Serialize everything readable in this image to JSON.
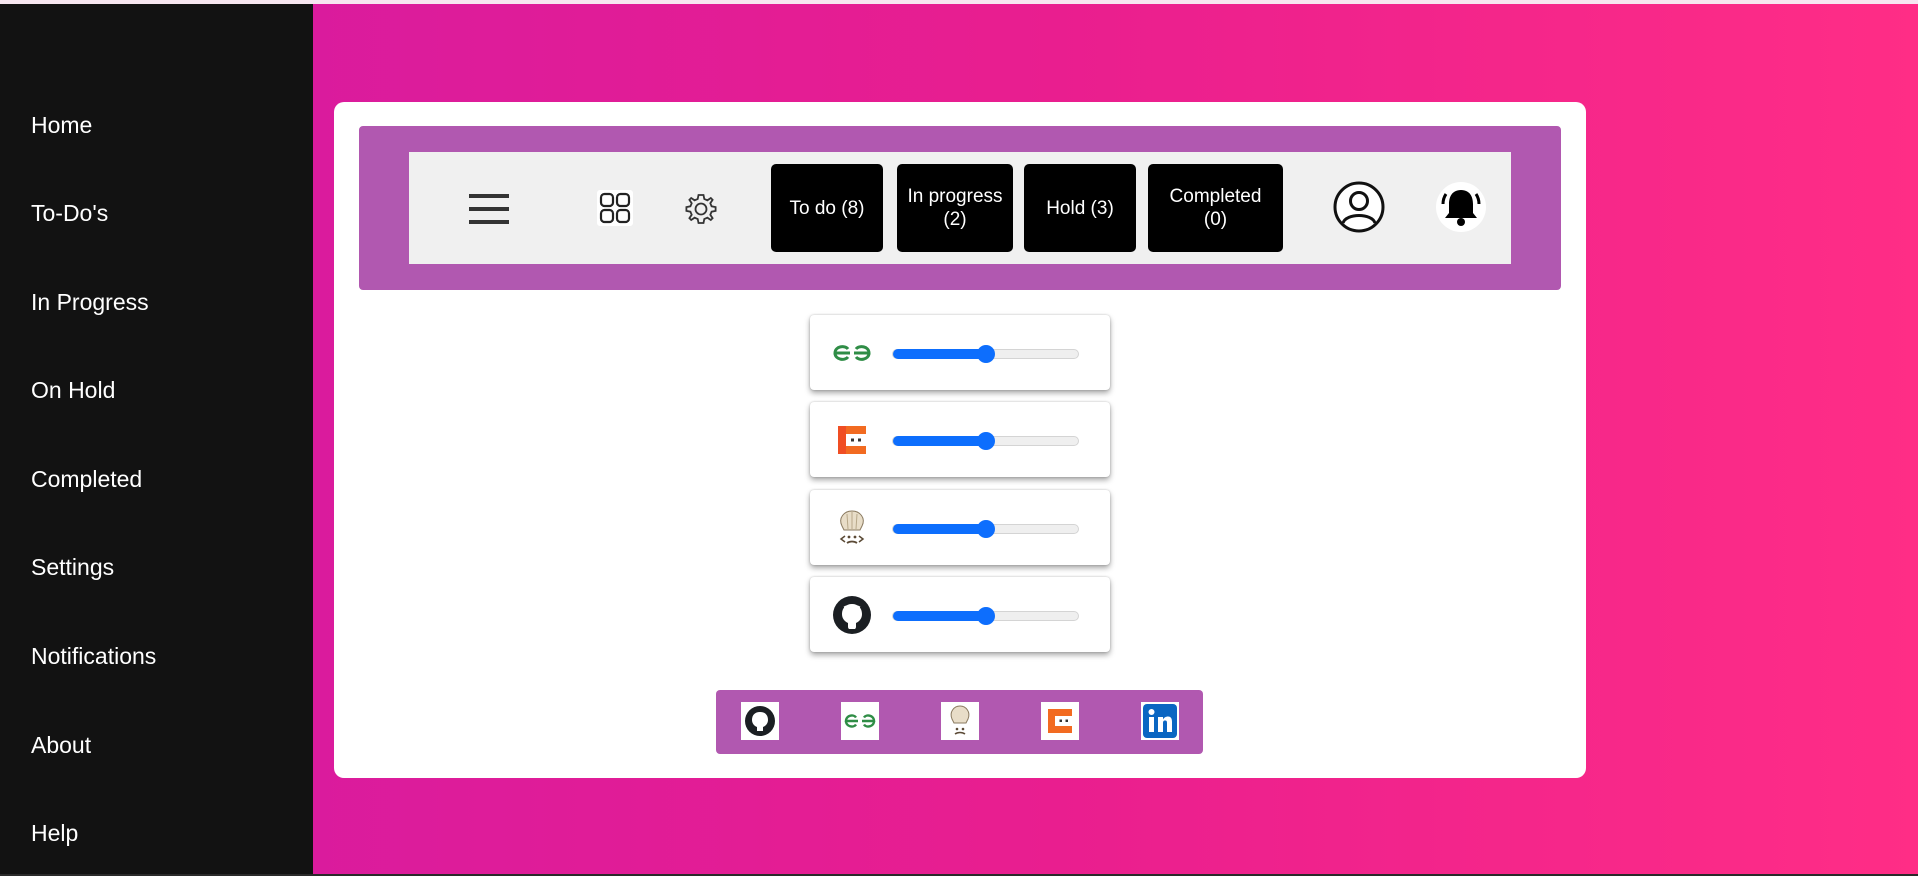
{
  "sidebar": {
    "items": [
      {
        "label": "Home"
      },
      {
        "label": "To-Do's"
      },
      {
        "label": "In Progress"
      },
      {
        "label": "On Hold"
      },
      {
        "label": "Completed"
      },
      {
        "label": "Settings"
      },
      {
        "label": "Notifications"
      },
      {
        "label": "About"
      },
      {
        "label": "Help"
      }
    ]
  },
  "toolbar": {
    "icons": [
      "menu-icon",
      "grid-icon",
      "gear-icon",
      "user-icon",
      "bell-icon"
    ],
    "status_buttons": [
      {
        "label": "To do (8)"
      },
      {
        "label": "In progress (2)"
      },
      {
        "label": "Hold (3)"
      },
      {
        "label": "Completed (0)"
      }
    ]
  },
  "sliders": [
    {
      "logo": "geeksforgeeks-icon",
      "value": 0.5
    },
    {
      "logo": "codingninjas-icon",
      "value": 0.5
    },
    {
      "logo": "codechef-icon",
      "value": 0.5
    },
    {
      "logo": "github-icon",
      "value": 0.5
    }
  ],
  "social": {
    "icons": [
      "github-icon",
      "geeksforgeeks-icon",
      "codechef-icon",
      "codingninjas-icon",
      "linkedin-icon"
    ]
  },
  "colors": {
    "sidebar_bg": "#121212",
    "accent_purple": "#b158b0",
    "slider_blue": "#0d6efd",
    "background_gradient_start": "#d41aa3",
    "background_gradient_end": "#ff2d86"
  }
}
